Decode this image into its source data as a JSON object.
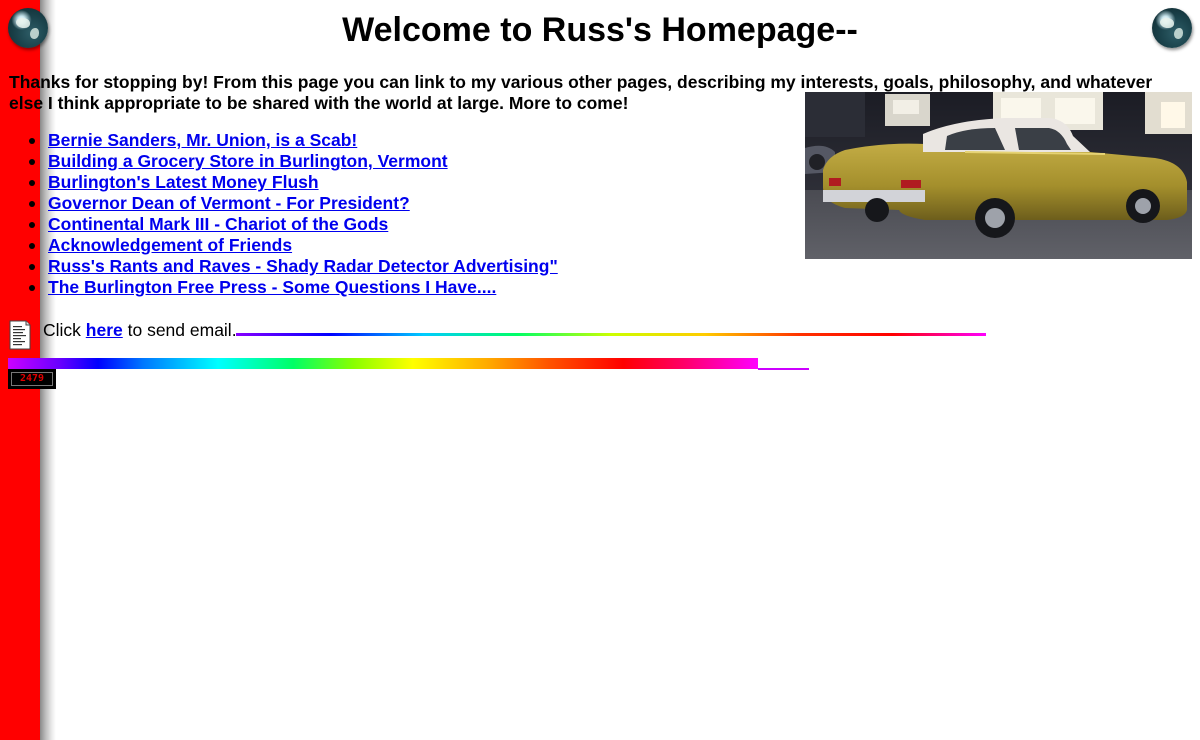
{
  "page": {
    "title": "Welcome to Russ's Homepage--",
    "intro": "Thanks for stopping by! From this page you can link to my various other pages, describing my interests, goals, philosophy, and whatever else I think appropriate to be shared with the world at large. More to come!"
  },
  "links": [
    "Bernie Sanders, Mr. Union, is a Scab!",
    "Building a Grocery Store in Burlington, Vermont",
    "Burlington's Latest Money Flush",
    "Governor Dean of Vermont - For President?",
    "Continental Mark III - Chariot of the Gods",
    "Acknowledgement of Friends",
    "Russ's Rants and Raves - Shady Radar Detector Advertising\"",
    "The Burlington Free Press - Some Questions I Have...."
  ],
  "email": {
    "prefix": "Click ",
    "link_text": "here",
    "suffix": " to send email."
  },
  "counter": {
    "value": "2479"
  },
  "colors": {
    "left_stripe": "#ff0000",
    "link": "#0000ee",
    "counter_digits": "#e00000"
  },
  "icons": {
    "globe_left": "globe-icon",
    "globe_right": "globe-icon",
    "mail": "mail-document-icon"
  }
}
